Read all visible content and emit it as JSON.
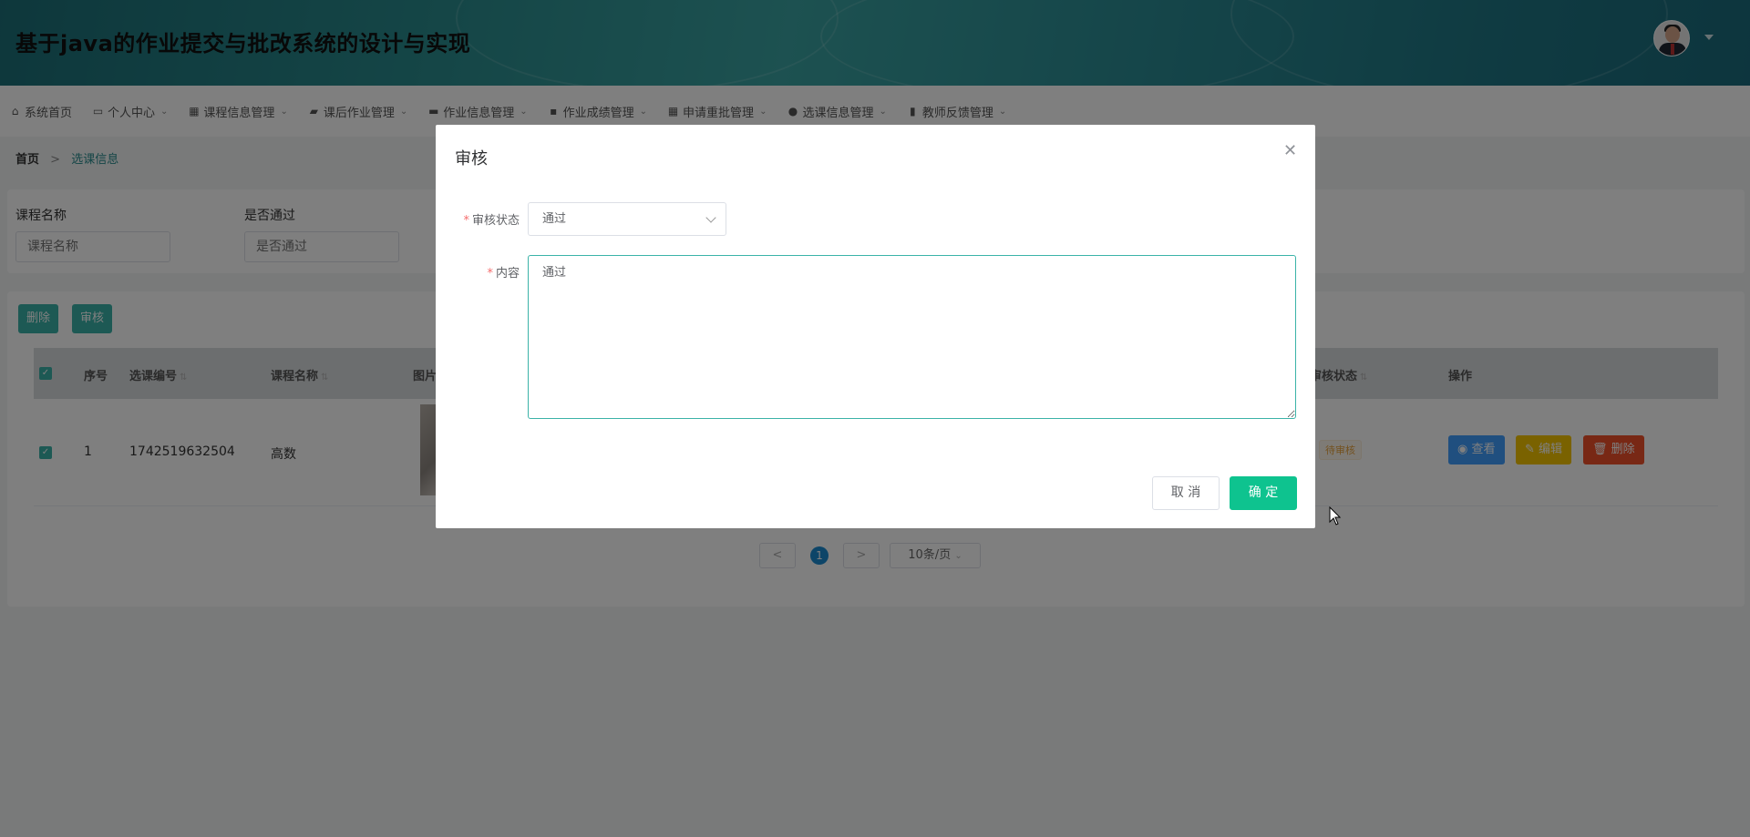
{
  "header": {
    "title": "基于java的作业提交与批改系统的设计与实现",
    "avatar_icon": "user-avatar",
    "caret_icon": "caret-down-icon"
  },
  "nav": {
    "items": [
      {
        "label": "系统首页",
        "icon": "home-icon",
        "has_caret": false
      },
      {
        "label": "个人中心",
        "icon": "card-icon",
        "has_caret": true
      },
      {
        "label": "课程信息管理",
        "icon": "grid-icon",
        "has_caret": true
      },
      {
        "label": "课后作业管理",
        "icon": "ticket-icon",
        "has_caret": true
      },
      {
        "label": "作业信息管理",
        "icon": "briefcase-icon",
        "has_caret": true
      },
      {
        "label": "作业成绩管理",
        "icon": "message-icon",
        "has_caret": true
      },
      {
        "label": "申请重批管理",
        "icon": "grid-icon",
        "has_caret": true
      },
      {
        "label": "选课信息管理",
        "icon": "balloon-icon",
        "has_caret": true
      },
      {
        "label": "教师反馈管理",
        "icon": "clipboard-icon",
        "has_caret": true
      }
    ]
  },
  "breadcrumb": {
    "home": "首页",
    "separator": ">",
    "current": "选课信息"
  },
  "search": {
    "course_label": "课程名称",
    "course_placeholder": "课程名称",
    "pass_label": "是否通过",
    "pass_placeholder": "是否通过"
  },
  "toolbar": {
    "delete_label": "删除",
    "review_label": "审核"
  },
  "table": {
    "headers": {
      "index": "序号",
      "selection_id": "选课编号",
      "course_name": "课程名称",
      "image": "图片",
      "review_status": "审核状态",
      "actions": "操作"
    },
    "rows": [
      {
        "index": "1",
        "selection_id": "1742519632504",
        "course_name": "高数",
        "review_status": "待审核",
        "view_label": "查看",
        "edit_label": "编辑",
        "delete_label": "删除"
      }
    ]
  },
  "pagination": {
    "prev": "<",
    "current_page": "1",
    "next": ">",
    "page_size": "10条/页"
  },
  "dialog": {
    "title": "审核",
    "status_label": "审核状态",
    "status_value": "通过",
    "content_label": "内容",
    "content_value": "通过",
    "cancel_label": "取 消",
    "confirm_label": "确 定",
    "required_mark": "*"
  },
  "colors": {
    "accent": "#3bb3a8",
    "confirm": "#0ec38f",
    "primary_blue": "#409eff",
    "warning": "#f5c400",
    "danger": "#f0502a"
  }
}
